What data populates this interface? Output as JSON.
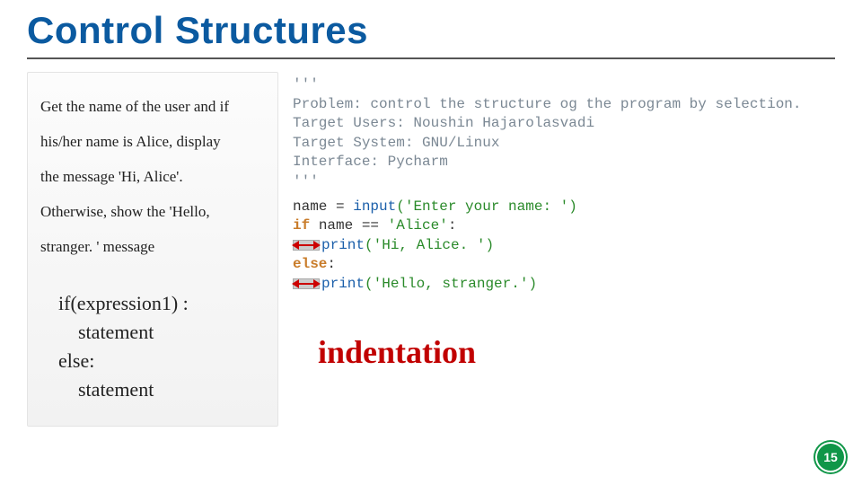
{
  "title": "Control Structures",
  "task": {
    "line1": "Get the name of the user and if",
    "line2": "his/her name is Alice, display",
    "line3": "the message 'Hi, Alice'.",
    "line4": "Otherwise, show the 'Hello,",
    "line5": "stranger. ' message"
  },
  "syntax": {
    "l1": "if(expression1) :",
    "l2": "statement",
    "l3": "else:",
    "l4": "statement"
  },
  "code": {
    "doc_open": "'''",
    "doc1": "Problem: control the structure og the program by selection.",
    "doc2": "Target Users: Noushin Hajarolasvadi",
    "doc3": "Target System: GNU/Linux",
    "doc4": "Interface: Pycharm",
    "doc_close": "'''",
    "name_var": "name ",
    "eq": "= ",
    "input_fn": "input",
    "input_arg": "('Enter your name: ')",
    "if_kw": "if ",
    "if_cond": "name == ",
    "alice_str": "'Alice'",
    "colon": ":",
    "print_fn": "print",
    "hi_arg": "('Hi, Alice. ')",
    "else_kw": "else",
    "hello_arg": "('Hello, stranger.')"
  },
  "indentation_label": "indentation",
  "page_number": "15"
}
